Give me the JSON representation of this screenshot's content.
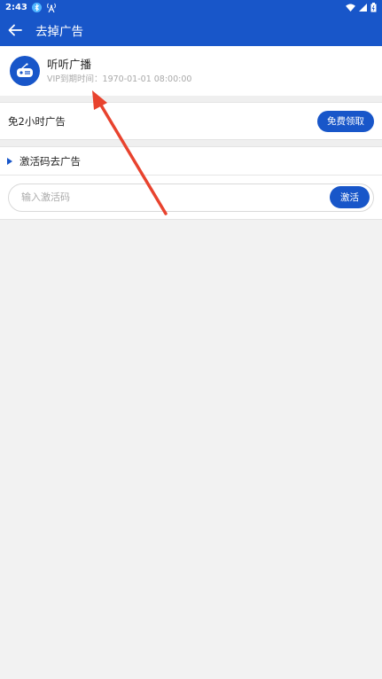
{
  "status_bar": {
    "time": "2:43"
  },
  "app_bar": {
    "title": "去掉广告"
  },
  "profile": {
    "name": "听听广播",
    "vip_expiry": "VIP到期时间：1970-01-01 08:00:00"
  },
  "free_ads": {
    "label": "免2小时广告",
    "button_label": "免费领取"
  },
  "activation": {
    "header_label": "激活码去广告",
    "input_placeholder": "输入激活码",
    "input_value": "",
    "button_label": "激活"
  },
  "colors": {
    "primary": "#1856c9",
    "annotation_arrow": "#e8432e"
  },
  "icons": {
    "back": "arrow-left-icon",
    "app_avatar": "radio-icon",
    "status": [
      "bluetooth-icon",
      "antenna-icon",
      "wifi-icon",
      "signal-icon",
      "battery-icon"
    ]
  }
}
